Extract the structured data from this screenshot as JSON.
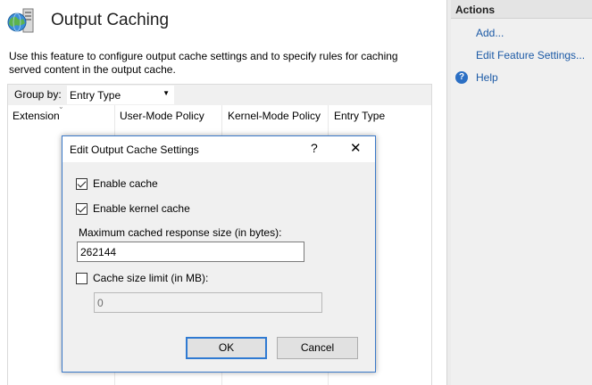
{
  "page": {
    "title": "Output Caching",
    "description": "Use this feature to configure output cache settings and to specify rules for caching served content in the output cache.",
    "icon": "globe-server-icon"
  },
  "groupby": {
    "label": "Group by:",
    "selected": "Entry Type"
  },
  "columns": [
    "Extension",
    "User-Mode Policy",
    "Kernel-Mode Policy",
    "Entry Type"
  ],
  "actions": {
    "header": "Actions",
    "items": [
      "Add...",
      "Edit Feature Settings...",
      "Help"
    ]
  },
  "dialog": {
    "title": "Edit Output Cache Settings",
    "help_glyph": "?",
    "close_glyph": "✕",
    "enable_cache_label": "Enable cache",
    "enable_cache_checked": true,
    "enable_kernel_label": "Enable kernel cache",
    "enable_kernel_checked": true,
    "max_response_label": "Maximum cached response size (in bytes):",
    "max_response_value": "262144",
    "size_limit_label": "Cache size limit (in MB):",
    "size_limit_checked": false,
    "size_limit_value": "0",
    "ok_label": "OK",
    "cancel_label": "Cancel"
  },
  "colors": {
    "link": "#1c5aa6",
    "dialog_border": "#3b79c9",
    "default_button_border": "#2f7ad2"
  }
}
